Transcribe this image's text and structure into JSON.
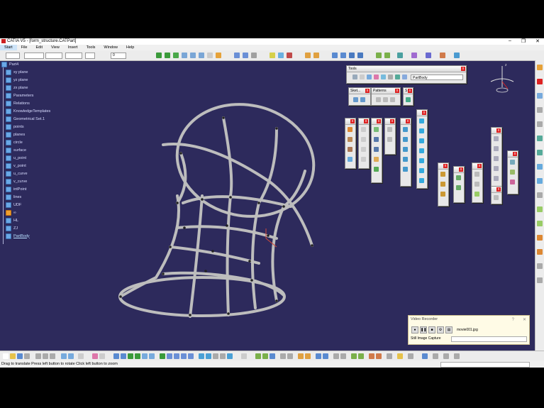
{
  "window": {
    "title": "CATIA V5 - [form_structure.CATPart]",
    "controls": [
      "–",
      "❐",
      "✕"
    ]
  },
  "menu": [
    "Start",
    "File",
    "Edit",
    "View",
    "Insert",
    "Tools",
    "Window",
    "Help"
  ],
  "toolbar": {
    "zoom_value": "0"
  },
  "tree": {
    "root": "Part4",
    "items": [
      {
        "label": "xy plane"
      },
      {
        "label": "yz plane"
      },
      {
        "label": "zx plane"
      },
      {
        "label": "Parameters"
      },
      {
        "label": "Relations"
      },
      {
        "label": "KnowledgeTemplates"
      },
      {
        "label": "Geometrical Set.1"
      },
      {
        "label": "points"
      },
      {
        "label": "planes"
      },
      {
        "label": "circle"
      },
      {
        "label": "surface"
      },
      {
        "label": "u_point"
      },
      {
        "label": "v_point"
      },
      {
        "label": "u_curve"
      },
      {
        "label": "v_curve"
      },
      {
        "label": "intPoint"
      },
      {
        "label": "lines"
      },
      {
        "label": "UDF"
      },
      {
        "label": "∞"
      },
      {
        "label": "HL"
      },
      {
        "label": "ZJ"
      },
      {
        "label": "PartBody"
      }
    ]
  },
  "panels": {
    "tools_title": "Tools",
    "tools_combo": "PartBody",
    "sketch_title": "Sket...",
    "patterns_title": "Patterns",
    "small_title": "S"
  },
  "recorder": {
    "title": "Video Recorder",
    "file": "movie001.jpg",
    "mode": "Still Image Capture"
  },
  "status": {
    "text": "Drag to translate  Press left button to rotate  Click left button to zoom"
  },
  "compass": {
    "label": "z"
  }
}
